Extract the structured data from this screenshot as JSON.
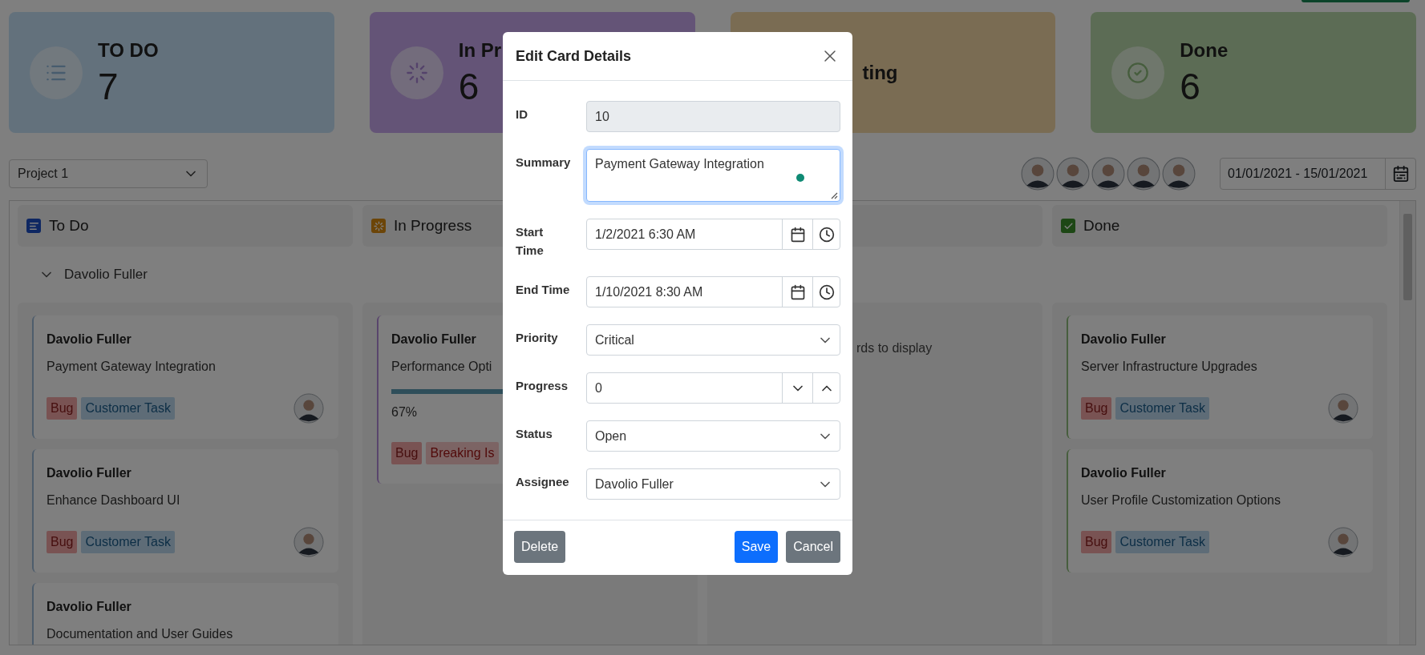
{
  "stats": [
    {
      "kind": "todo",
      "title": "TO DO",
      "count": "7"
    },
    {
      "kind": "progress",
      "title": "In Pr",
      "count": "6"
    },
    {
      "kind": "waiting",
      "title": "ting"
    },
    {
      "kind": "done",
      "title": "Done",
      "count": "6"
    }
  ],
  "toolbar": {
    "project": "Project 1",
    "date_range": "01/01/2021 - 15/01/2021"
  },
  "board": {
    "columns": [
      {
        "kind": "todo",
        "title": "To Do"
      },
      {
        "kind": "progress",
        "title": "In Progress"
      },
      {
        "kind": "waiting"
      },
      {
        "kind": "done",
        "title": "Done"
      }
    ],
    "swimlane": {
      "title": "Davolio Fuller",
      "expanded": true
    },
    "lanes": [
      {
        "cards": [
          {
            "assignee": "Davolio Fuller",
            "summary": "Payment Gateway Integration",
            "tags": [
              {
                "kind": "bug",
                "label": "Bug"
              },
              {
                "kind": "customer",
                "label": "Customer Task"
              }
            ],
            "avatar": true
          },
          {
            "assignee": "Davolio Fuller",
            "summary": "Enhance Dashboard UI",
            "tags": [
              {
                "kind": "bug",
                "label": "Bug"
              },
              {
                "kind": "customer",
                "label": "Customer Task"
              }
            ],
            "avatar": true
          },
          {
            "assignee": "Davolio Fuller",
            "summary": "Documentation and User Guides",
            "avatar": false
          }
        ]
      },
      {
        "cards": [
          {
            "assignee": "Davolio Fuller",
            "summary": "Performance Opti",
            "level": 0.67,
            "progress_text": "67%",
            "tags": [
              {
                "kind": "bug",
                "label": "Bug"
              },
              {
                "kind": "breaking",
                "label": "Breaking Is"
              }
            ],
            "avatar": false
          }
        ]
      },
      {
        "empty_text": "rds to display"
      },
      {
        "cards": [
          {
            "assignee": "Davolio Fuller",
            "summary": "Server Infrastructure Upgrades",
            "tags": [
              {
                "kind": "bug",
                "label": "Bug"
              },
              {
                "kind": "customer",
                "label": "Customer Task"
              }
            ],
            "avatar": true
          },
          {
            "assignee": "Davolio Fuller",
            "summary": "User Profile Customization Options",
            "tags": [
              {
                "kind": "bug",
                "label": "Bug"
              },
              {
                "kind": "customer",
                "label": "Customer Task"
              }
            ],
            "avatar": true
          }
        ]
      }
    ]
  },
  "dialog": {
    "title": "Edit Card Details",
    "fields": [
      {
        "kind": "text",
        "label": "ID",
        "value": "10",
        "disabled": true,
        "focused": false
      },
      {
        "kind": "textarea",
        "label": "Summary",
        "value": "Payment Gateway Integration",
        "disabled": false,
        "focused": true
      },
      {
        "kind": "datetime",
        "label": "Start Time",
        "value": "1/2/2021 6:30 AM",
        "disabled": false,
        "focused": false
      },
      {
        "kind": "datetime",
        "label": "End Time",
        "value": "1/10/2021 8:30 AM",
        "disabled": false,
        "focused": false
      },
      {
        "kind": "select",
        "label": "Priority",
        "value": "Critical",
        "disabled": false,
        "focused": false
      },
      {
        "kind": "numeric",
        "label": "Progress",
        "value": "0",
        "disabled": false,
        "focused": false
      },
      {
        "kind": "select",
        "label": "Status",
        "value": "Open",
        "disabled": false,
        "focused": false
      },
      {
        "kind": "select",
        "label": "Assignee",
        "value": "Davolio Fuller",
        "disabled": false,
        "focused": false
      }
    ],
    "buttons": [
      {
        "kind": "secondary",
        "label": "Delete"
      },
      {
        "kind": "primary",
        "label": "Save"
      },
      {
        "kind": "secondary",
        "label": "Cancel"
      }
    ]
  }
}
